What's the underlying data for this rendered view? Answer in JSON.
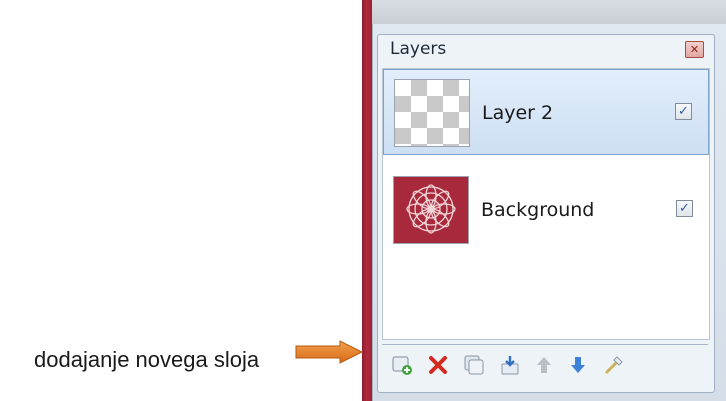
{
  "panel": {
    "title": "Layers",
    "close_icon": "close-icon"
  },
  "layers": [
    {
      "name": "Layer 2",
      "visible": true,
      "selected": true,
      "thumbnail": "transparent-checkerboard"
    },
    {
      "name": "Background",
      "visible": true,
      "selected": false,
      "thumbnail": "red-mandala-image"
    }
  ],
  "toolbar": {
    "buttons": [
      "add-layer-icon",
      "delete-layer-icon",
      "duplicate-layer-icon",
      "merge-layer-down-icon",
      "move-layer-up-icon",
      "move-layer-down-icon",
      "layer-properties-icon"
    ]
  },
  "annotation": {
    "caption": "dodajanje novega sloja",
    "arrow_color": "#e07b22"
  },
  "colors": {
    "selection": "#cddff3",
    "canvas_edge": "#a8283c"
  }
}
